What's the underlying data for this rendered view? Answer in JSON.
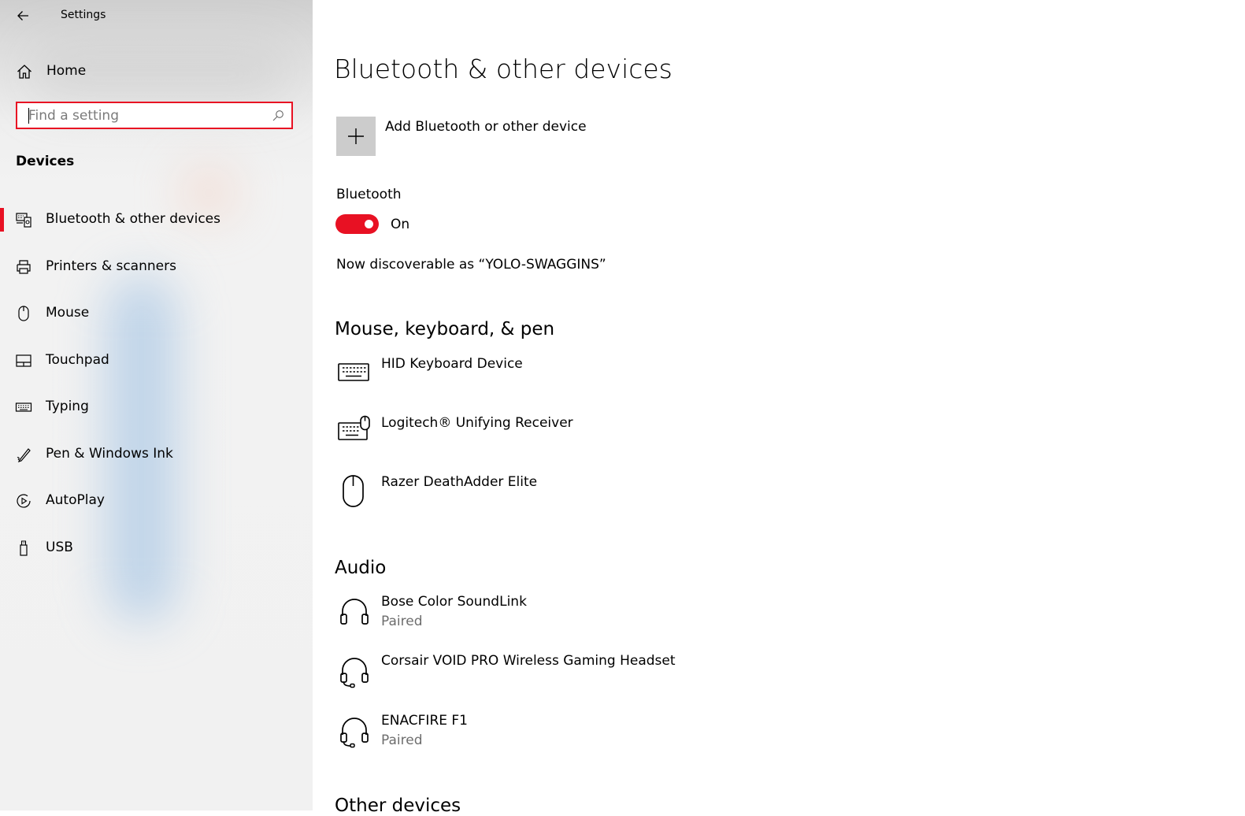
{
  "window": {
    "title": "Settings"
  },
  "sidebar": {
    "home_label": "Home",
    "search_placeholder": "Find a setting",
    "section_label": "Devices",
    "items": [
      {
        "label": "Bluetooth & other devices",
        "icon": "bluetooth-devices-icon",
        "selected": true
      },
      {
        "label": "Printers & scanners",
        "icon": "printer-icon",
        "selected": false
      },
      {
        "label": "Mouse",
        "icon": "mouse-icon",
        "selected": false
      },
      {
        "label": "Touchpad",
        "icon": "touchpad-icon",
        "selected": false
      },
      {
        "label": "Typing",
        "icon": "keyboard-icon",
        "selected": false
      },
      {
        "label": "Pen & Windows Ink",
        "icon": "pen-icon",
        "selected": false
      },
      {
        "label": "AutoPlay",
        "icon": "autoplay-icon",
        "selected": false
      },
      {
        "label": "USB",
        "icon": "usb-icon",
        "selected": false
      }
    ]
  },
  "main": {
    "title": "Bluetooth & other devices",
    "add_device_label": "Add Bluetooth or other device",
    "bluetooth": {
      "label": "Bluetooth",
      "state_label": "On",
      "enabled": true,
      "discoverable_text": "Now discoverable as “YOLO-SWAGGINS”"
    },
    "sections": [
      {
        "heading": "Mouse, keyboard, & pen",
        "devices": [
          {
            "name": "HID Keyboard Device",
            "status": "",
            "icon": "keyboard-icon"
          },
          {
            "name": "Logitech® Unifying Receiver",
            "status": "",
            "icon": "keyboard-mouse-icon"
          },
          {
            "name": "Razer DeathAdder Elite",
            "status": "",
            "icon": "mouse-icon"
          }
        ]
      },
      {
        "heading": "Audio",
        "devices": [
          {
            "name": "Bose Color SoundLink",
            "status": "Paired",
            "icon": "headphones-icon"
          },
          {
            "name": "Corsair VOID PRO Wireless Gaming Headset",
            "status": "",
            "icon": "headset-icon"
          },
          {
            "name": "ENACFIRE F1",
            "status": "Paired",
            "icon": "headset-icon"
          }
        ]
      },
      {
        "heading": "Other devices",
        "devices": []
      }
    ]
  },
  "colors": {
    "accent": "#e81123",
    "sidebar_bg": "#f2f2f2",
    "tile_bg": "#cccccc",
    "secondary_text": "#6d6d6d"
  }
}
